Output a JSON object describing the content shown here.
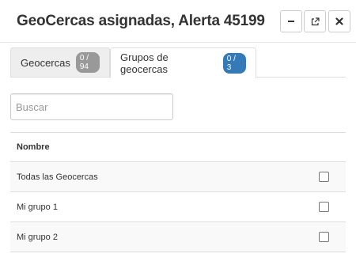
{
  "header": {
    "title": "GeoCercas asignadas, Alerta 45199",
    "buttons": [
      {
        "name": "minimize",
        "icon": "minus-icon"
      },
      {
        "name": "popout",
        "icon": "external-link-icon"
      },
      {
        "name": "close",
        "icon": "close-icon"
      }
    ]
  },
  "tabs": [
    {
      "label": "Geocercas",
      "badge": "0 / 94",
      "active": false
    },
    {
      "label": "Grupos de geocercas",
      "badge": "0 / 3",
      "active": true
    }
  ],
  "search": {
    "placeholder": "Buscar",
    "value": ""
  },
  "table": {
    "header": "Nombre",
    "rows": [
      {
        "name": "Todas las Geocercas",
        "checked": false
      },
      {
        "name": "Mi grupo 1",
        "checked": false
      },
      {
        "name": "Mi grupo 2",
        "checked": false
      }
    ]
  },
  "colors": {
    "badge_inactive": "#999999",
    "badge_active": "#337ab7",
    "border": "#dddddd",
    "striped_row": "#f9f9f9"
  }
}
